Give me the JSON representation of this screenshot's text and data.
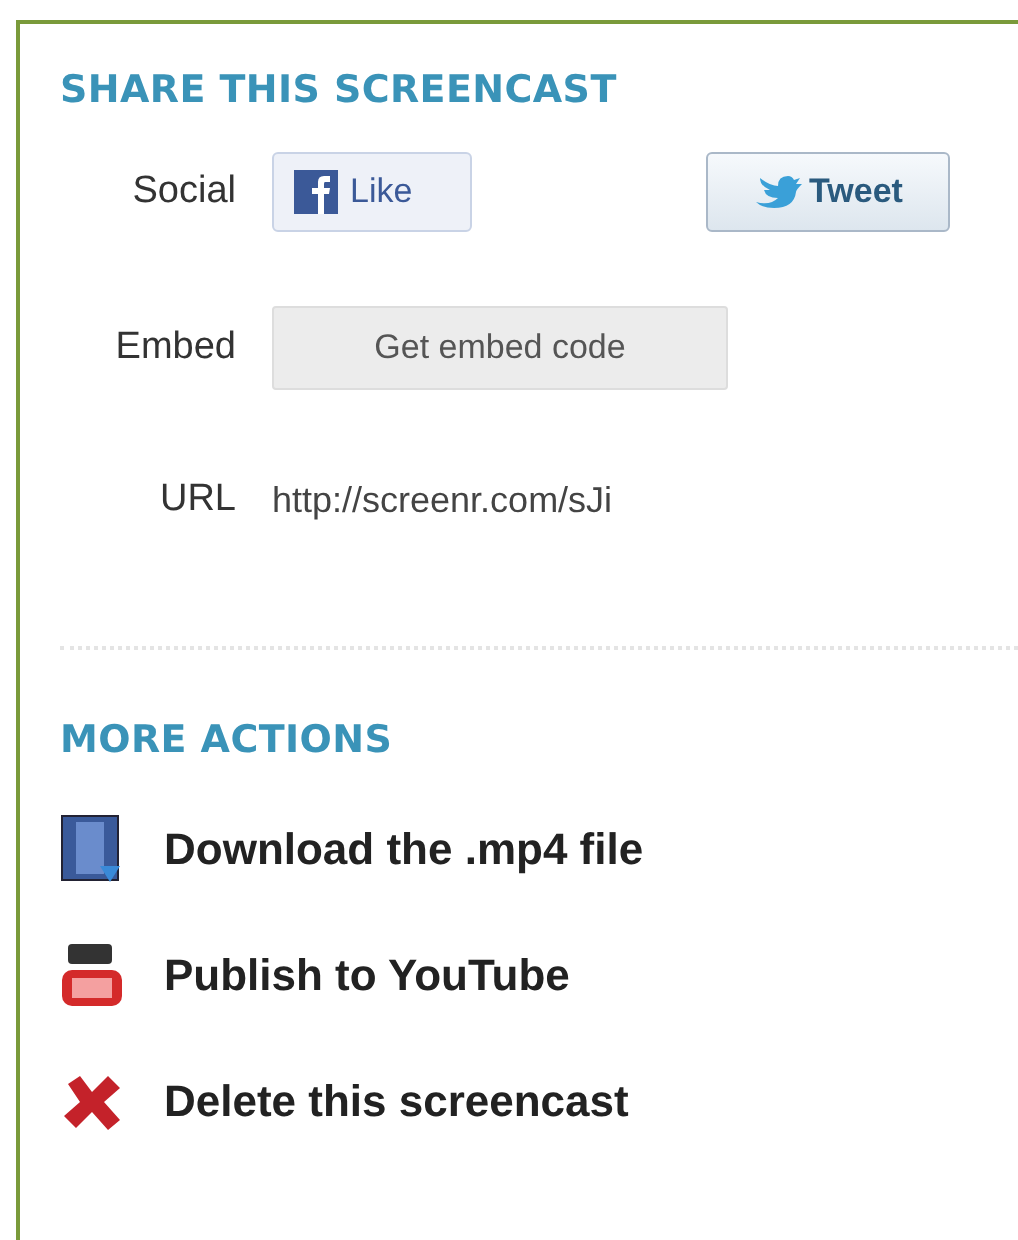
{
  "share": {
    "title": "SHARE THIS SCREENCAST",
    "rows": [
      {
        "kind": "social",
        "label": "Social",
        "buttons": [
          {
            "kind": "facebook",
            "label": "Like"
          },
          {
            "kind": "twitter",
            "label": "Tweet"
          }
        ]
      },
      {
        "kind": "embed",
        "label": "Embed",
        "button": "Get embed code"
      },
      {
        "kind": "url",
        "label": "URL",
        "value": "http://screenr.com/sJi"
      }
    ]
  },
  "more_actions": {
    "title": "MORE ACTIONS",
    "items": [
      {
        "kind": "download",
        "label": "Download the .mp4 file"
      },
      {
        "kind": "youtube",
        "label": "Publish to YouTube"
      },
      {
        "kind": "delete",
        "label": "Delete this screencast"
      }
    ]
  }
}
